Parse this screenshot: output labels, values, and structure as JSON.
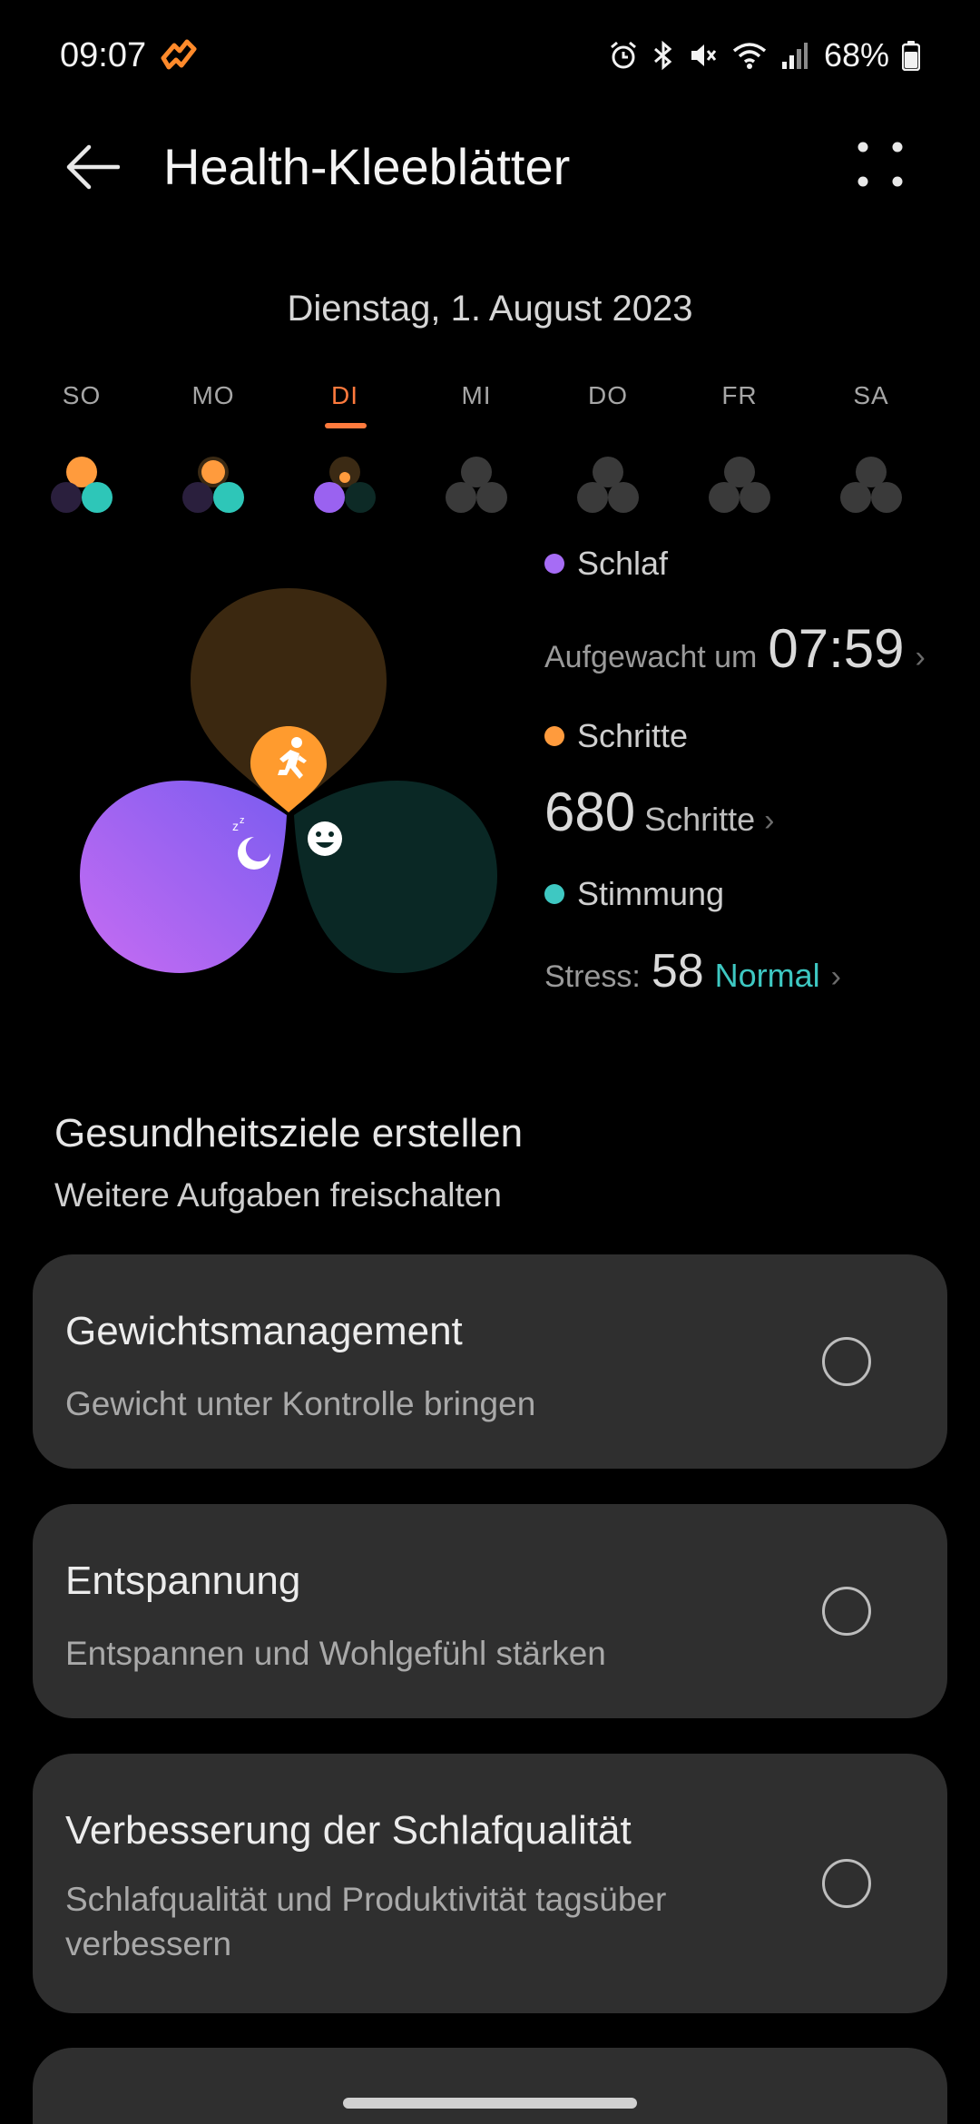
{
  "status_bar": {
    "time": "09:07",
    "battery": "68%",
    "icons": [
      "alarm-icon",
      "bluetooth-icon",
      "mute-icon",
      "wifi-icon",
      "signal-icon",
      "battery-icon"
    ]
  },
  "header": {
    "title": "Health-Kleeblätter"
  },
  "date": "Dienstag, 1. August 2023",
  "week": {
    "days": [
      {
        "label": "SO",
        "sleep": 0.0,
        "steps": 1.0,
        "mood": 1.0
      },
      {
        "label": "MO",
        "sleep": 0.0,
        "steps": 1.0,
        "mood": 1.0
      },
      {
        "label": "DI",
        "sleep": 1.0,
        "steps": 0.2,
        "mood": 0.0
      },
      {
        "label": "MI",
        "sleep": 0.0,
        "steps": 0.0,
        "mood": 0.0
      },
      {
        "label": "DO",
        "sleep": 0.0,
        "steps": 0.0,
        "mood": 0.0
      },
      {
        "label": "FR",
        "sleep": 0.0,
        "steps": 0.0,
        "mood": 0.0
      },
      {
        "label": "SA",
        "sleep": 0.0,
        "steps": 0.0,
        "mood": 0.0
      }
    ],
    "selected": "DI"
  },
  "metrics": {
    "sleep": {
      "label": "Schlaf",
      "prefix": "Aufgewacht um",
      "value": "07:59"
    },
    "steps": {
      "label": "Schritte",
      "value": "680",
      "unit": "Schritte"
    },
    "mood": {
      "label": "Stimmung",
      "prefix": "Stress:",
      "value": "58",
      "level": "Normal"
    }
  },
  "colors": {
    "accent": "#ff7a3d",
    "sleep": "#a66cf5",
    "steps": "#ff9b3d",
    "mood": "#3ec8c2",
    "card_bg": "#2f2f2f"
  },
  "goals": {
    "title": "Gesundheitsziele erstellen",
    "subtitle": "Weitere Aufgaben freischalten",
    "items": [
      {
        "title": "Gewichtsmanagement",
        "subtitle": "Gewicht unter Kontrolle bringen"
      },
      {
        "title": "Entspannung",
        "subtitle": "Entspannen und Wohlgefühl stärken"
      },
      {
        "title": "Verbesserung der Schlafqualität",
        "subtitle": "Schlafqualität und Produktivität tagsüber verbessern"
      }
    ]
  }
}
